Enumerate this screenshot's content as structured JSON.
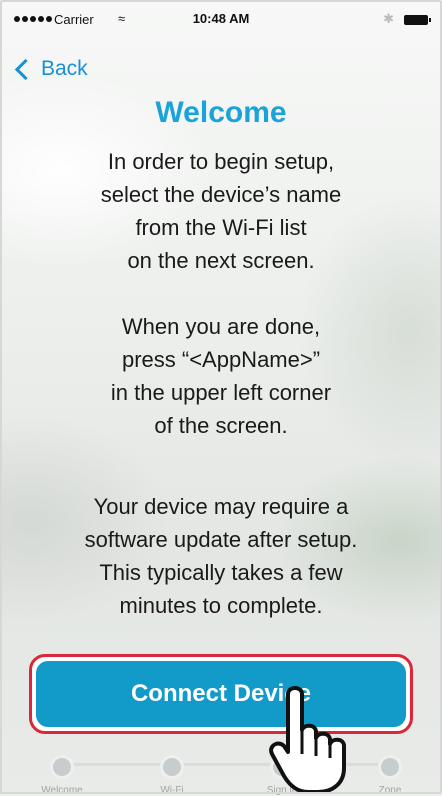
{
  "status_bar": {
    "carrier": "Carrier",
    "time": "10:48 AM",
    "wifi_icon": "wifi-icon",
    "bluetooth_icon": "bluetooth-icon",
    "battery_icon": "battery-icon"
  },
  "nav": {
    "back_label": "Back"
  },
  "title": "Welcome",
  "paragraphs": {
    "p1": [
      "In order to begin setup,",
      "select the device’s name",
      "from the Wi-Fi list",
      "on the next screen."
    ],
    "p2": [
      "When you are done,",
      "press “<AppName>”",
      "in the upper left corner",
      "of the screen."
    ],
    "p3": [
      "Your device may require a",
      "software update after setup.",
      "This typically takes a few",
      "minutes to complete."
    ]
  },
  "connect_button": {
    "label": "Connect Device",
    "highlight_color": "#d9283a",
    "fill_color": "#129ac9"
  },
  "progress_steps": [
    {
      "label": "Welcome"
    },
    {
      "label": "Wi-Fi"
    },
    {
      "label": "Sign in"
    },
    {
      "label": "Zone"
    }
  ],
  "colors": {
    "accent": "#1a8fd4",
    "title": "#1aa3d8"
  },
  "pointer_icon": "hand-pointer-icon"
}
